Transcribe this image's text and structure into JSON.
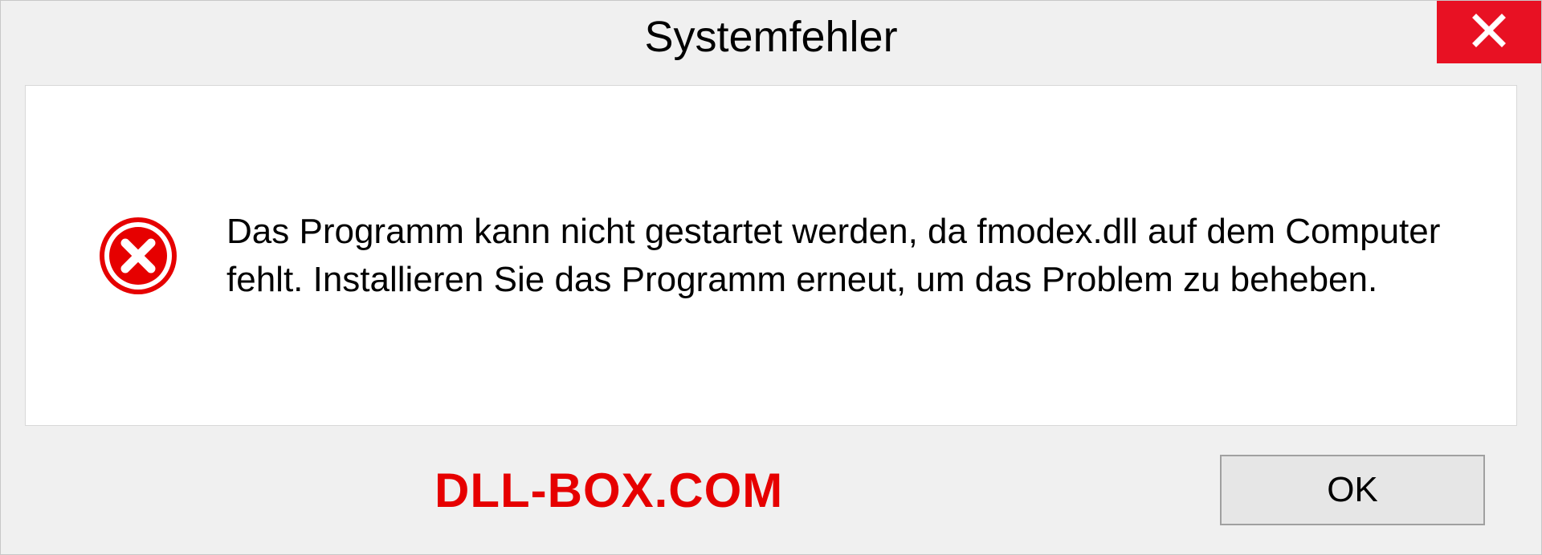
{
  "dialog": {
    "title": "Systemfehler",
    "message": "Das Programm kann nicht gestartet werden, da fmodex.dll auf dem Computer fehlt. Installieren Sie das Programm erneut, um das Problem zu beheben.",
    "ok_label": "OK"
  },
  "watermark": "DLL-BOX.COM"
}
